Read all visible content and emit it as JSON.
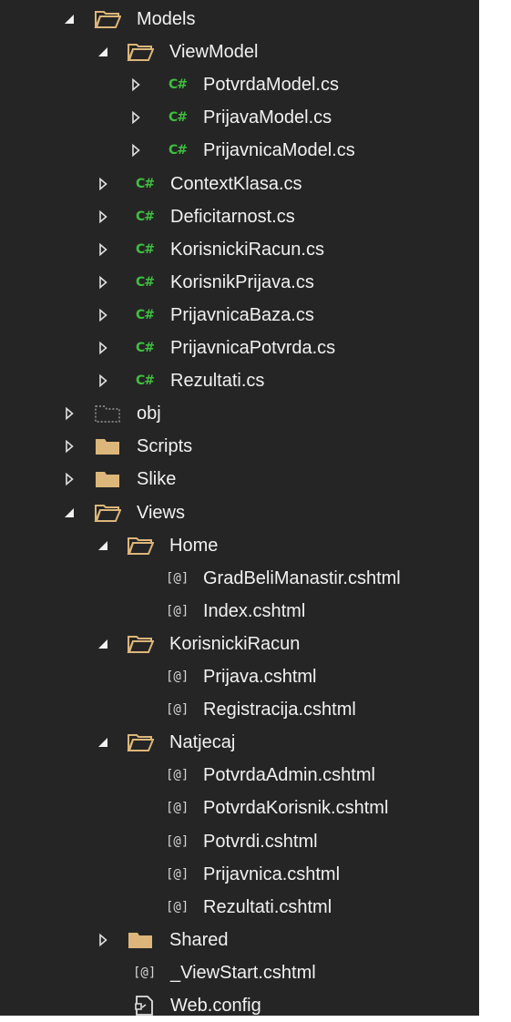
{
  "tree": [
    {
      "label": "Models",
      "icon": "folder-open-icon",
      "state": "expanded"
    },
    {
      "label": "ViewModel",
      "icon": "folder-open-icon",
      "state": "expanded"
    },
    {
      "label": "PotvrdaModel.cs",
      "icon": "csharp-file-icon",
      "state": "collapsed"
    },
    {
      "label": "PrijavaModel.cs",
      "icon": "csharp-file-icon",
      "state": "collapsed"
    },
    {
      "label": "PrijavnicaModel.cs",
      "icon": "csharp-file-icon",
      "state": "collapsed"
    },
    {
      "label": "ContextKlasa.cs",
      "icon": "csharp-file-icon",
      "state": "collapsed"
    },
    {
      "label": "Deficitarnost.cs",
      "icon": "csharp-file-icon",
      "state": "collapsed"
    },
    {
      "label": "KorisnickiRacun.cs",
      "icon": "csharp-file-icon",
      "state": "collapsed"
    },
    {
      "label": "KorisnikPrijava.cs",
      "icon": "csharp-file-icon",
      "state": "collapsed"
    },
    {
      "label": "PrijavnicaBaza.cs",
      "icon": "csharp-file-icon",
      "state": "collapsed"
    },
    {
      "label": "PrijavnicaPotvrda.cs",
      "icon": "csharp-file-icon",
      "state": "collapsed"
    },
    {
      "label": "Rezultati.cs",
      "icon": "csharp-file-icon",
      "state": "collapsed"
    },
    {
      "label": "obj",
      "icon": "hidden-folder-icon",
      "state": "collapsed"
    },
    {
      "label": "Scripts",
      "icon": "folder-icon",
      "state": "collapsed"
    },
    {
      "label": "Slike",
      "icon": "folder-icon",
      "state": "collapsed"
    },
    {
      "label": "Views",
      "icon": "folder-open-icon",
      "state": "expanded"
    },
    {
      "label": "Home",
      "icon": "folder-open-icon",
      "state": "expanded"
    },
    {
      "label": "GradBeliManastir.cshtml",
      "icon": "razor-file-icon",
      "state": "none"
    },
    {
      "label": "Index.cshtml",
      "icon": "razor-file-icon",
      "state": "none"
    },
    {
      "label": "KorisnickiRacun",
      "icon": "folder-open-icon",
      "state": "expanded"
    },
    {
      "label": "Prijava.cshtml",
      "icon": "razor-file-icon",
      "state": "none"
    },
    {
      "label": "Registracija.cshtml",
      "icon": "razor-file-icon",
      "state": "none"
    },
    {
      "label": "Natjecaj",
      "icon": "folder-open-icon",
      "state": "expanded"
    },
    {
      "label": "PotvrdaAdmin.cshtml",
      "icon": "razor-file-icon",
      "state": "none"
    },
    {
      "label": "PotvrdaKorisnik.cshtml",
      "icon": "razor-file-icon",
      "state": "none"
    },
    {
      "label": "Potvrdi.cshtml",
      "icon": "razor-file-icon",
      "state": "none"
    },
    {
      "label": "Prijavnica.cshtml",
      "icon": "razor-file-icon",
      "state": "none"
    },
    {
      "label": "Rezultati.cshtml",
      "icon": "razor-file-icon",
      "state": "none"
    },
    {
      "label": "Shared",
      "icon": "folder-icon",
      "state": "collapsed"
    },
    {
      "label": "_ViewStart.cshtml",
      "icon": "razor-file-icon",
      "state": "none"
    },
    {
      "label": "Web.config",
      "icon": "config-file-icon",
      "state": "none"
    }
  ],
  "icons": {
    "csharp_glyph": "C#",
    "razor_glyph": "[@]"
  },
  "colors": {
    "background": "#252526",
    "text": "#f1f1f1",
    "csharp": "#3fbf3f",
    "folder": "#dcb67a"
  }
}
